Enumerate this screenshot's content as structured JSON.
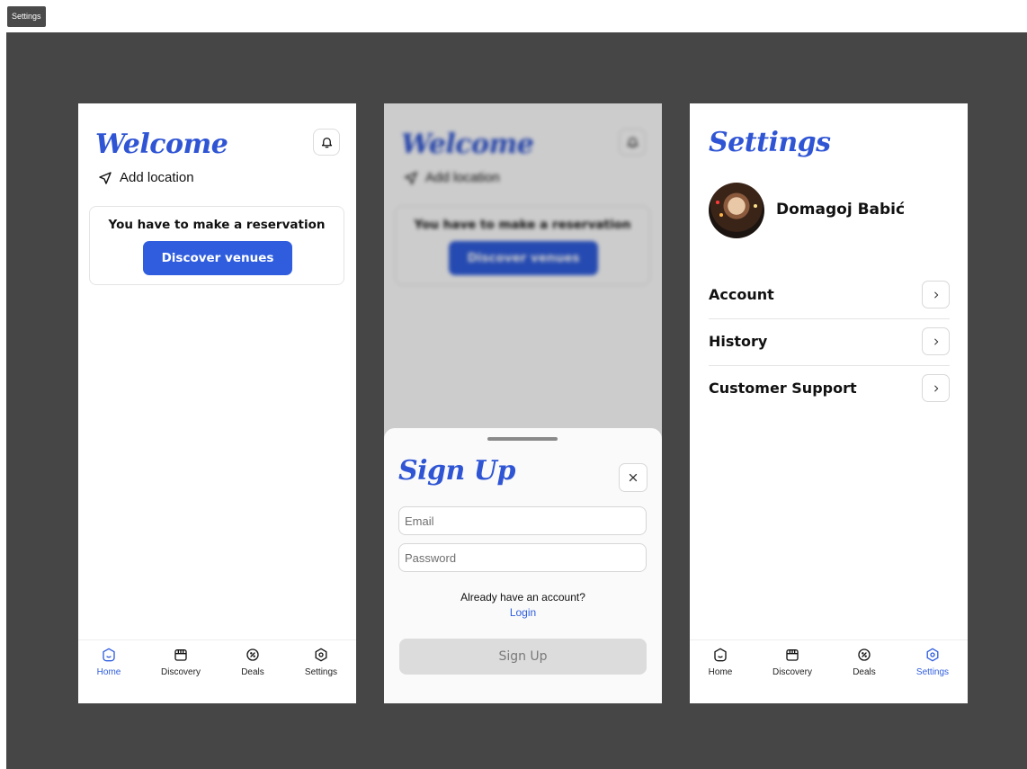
{
  "top_label": "Settings",
  "colors": {
    "accent": "#2f5dde",
    "canvas": "#464646",
    "title": "#2f55d4"
  },
  "home": {
    "title": "Welcome",
    "location_label": "Add location",
    "card_text": "You have to make a reservation",
    "discover_button": "Discover venues"
  },
  "tabs": [
    {
      "label": "Home",
      "icon": "home-icon"
    },
    {
      "label": "Discovery",
      "icon": "store-icon"
    },
    {
      "label": "Deals",
      "icon": "discount-icon"
    },
    {
      "label": "Settings",
      "icon": "settings-icon"
    }
  ],
  "signup": {
    "title": "Sign Up",
    "email_placeholder": "Email",
    "password_placeholder": "Password",
    "already_text": "Already have an account?",
    "login_link": "Login",
    "button": "Sign Up"
  },
  "settings": {
    "title": "Settings",
    "user_name": "Domagoj Babić",
    "menu": [
      {
        "label": "Account"
      },
      {
        "label": "History"
      },
      {
        "label": "Customer Support"
      }
    ]
  }
}
